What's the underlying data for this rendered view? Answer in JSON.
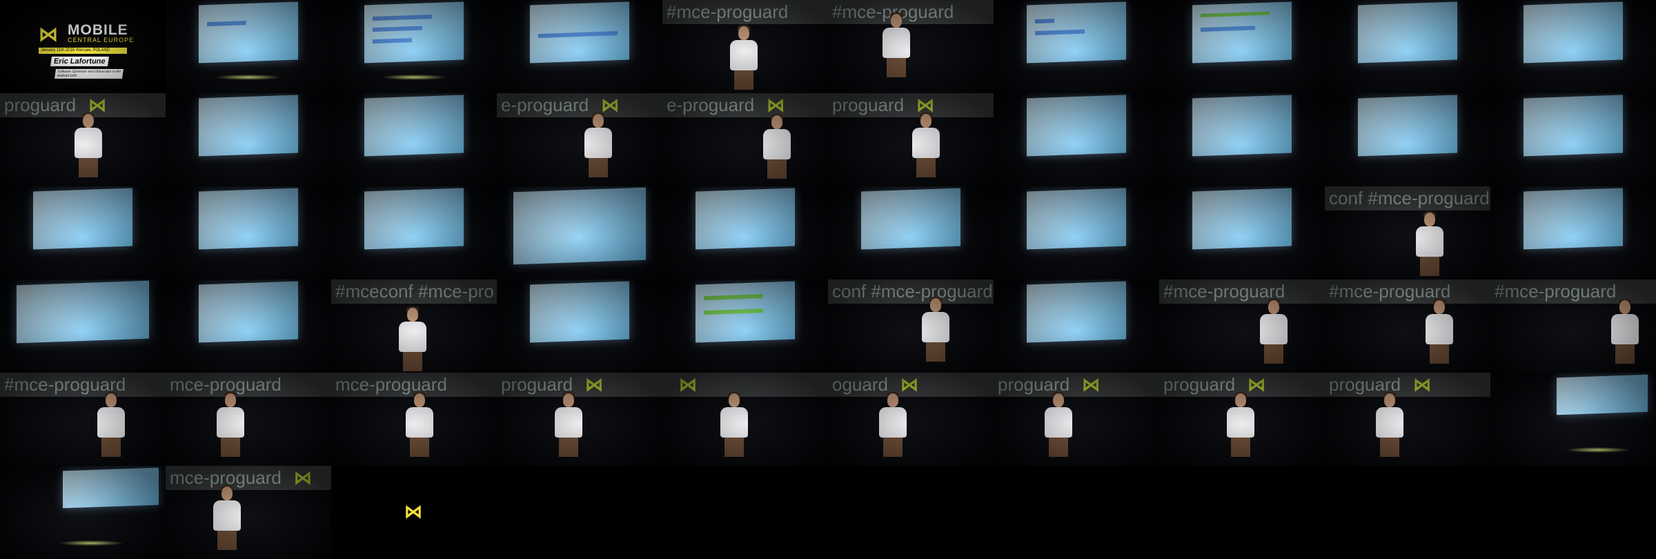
{
  "title_card": {
    "logo_icon": "mce-m-logo-icon",
    "brand_line1": "MOBILE",
    "brand_line2": "CENTRAL EUROPE",
    "date": "January 11th 2016 Warsaw, POLAND",
    "speaker": "Eric Lafortune",
    "talk": "Software Optimizer and Obfuscator in the Android SDK"
  },
  "banner_texts": {
    "hashtag": "#mce-proguard",
    "hashtag_crop": "mce-proguard",
    "proguard_crop": "proguard",
    "eproguard_crop": "e-proguard",
    "oguard_crop": "oguard",
    "conf_crop": "conf",
    "mceconf": "#mceconf",
    "mce_proguard_small": "#mce-pro"
  },
  "colors": {
    "accent_yellow": "#f1e337",
    "banner_gray": "#3a3d3e",
    "screen_blue": "#8fd0f5"
  },
  "end_logo_icon": "mce-m-logo-icon"
}
